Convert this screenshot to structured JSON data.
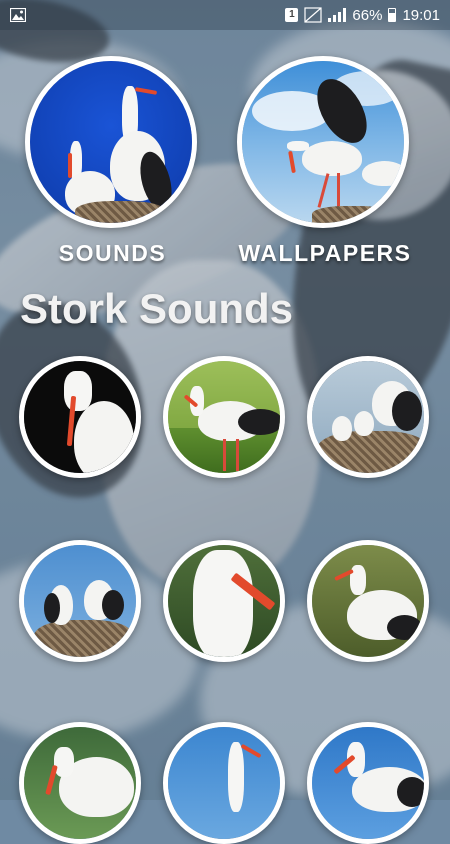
{
  "status_bar": {
    "notification_icon": "image-icon",
    "sim_badge": "1",
    "battery_percent": "66%",
    "time": "19:01"
  },
  "menu": {
    "sounds_label": "SOUNDS",
    "wallpapers_label": "WALLPAPERS"
  },
  "section": {
    "title": "Stork Sounds"
  },
  "grid": {
    "items": [
      {
        "name": "stork-sound-1"
      },
      {
        "name": "stork-sound-2"
      },
      {
        "name": "stork-sound-3"
      },
      {
        "name": "stork-sound-4"
      },
      {
        "name": "stork-sound-5"
      },
      {
        "name": "stork-sound-6"
      },
      {
        "name": "stork-sound-7"
      },
      {
        "name": "stork-sound-8"
      },
      {
        "name": "stork-sound-9"
      }
    ]
  },
  "colors": {
    "label_text": "#ffffff",
    "circle_border": "#ffffff",
    "beak": "#e24a2c"
  }
}
